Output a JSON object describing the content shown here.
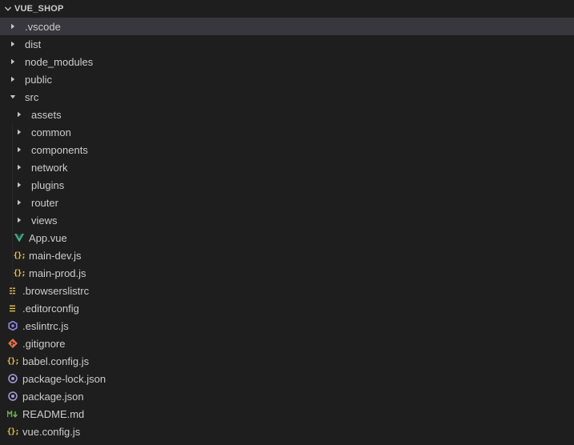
{
  "explorer": {
    "root_label": "VUE_SHOP",
    "colors": {
      "background": "#1e1e1e",
      "selected_row": "#37373d",
      "text": "#cccccc",
      "vue_icon": "#41b883",
      "js_icon": "#e8c04b",
      "config_icon": "#e8c04b",
      "eslint_icon": "#8d87e0",
      "git_icon": "#e5704a",
      "json_icon": "#a49cd8",
      "md_icon": "#6ab04c"
    },
    "items": [
      {
        "label": ".vscode",
        "kind": "folder",
        "state": "collapsed",
        "level": 0,
        "selected": true
      },
      {
        "label": "dist",
        "kind": "folder",
        "state": "collapsed",
        "level": 0
      },
      {
        "label": "node_modules",
        "kind": "folder",
        "state": "collapsed",
        "level": 0
      },
      {
        "label": "public",
        "kind": "folder",
        "state": "collapsed",
        "level": 0
      },
      {
        "label": "src",
        "kind": "folder",
        "state": "expanded",
        "level": 0
      },
      {
        "label": "assets",
        "kind": "folder",
        "state": "collapsed",
        "level": 1
      },
      {
        "label": "common",
        "kind": "folder",
        "state": "collapsed",
        "level": 1
      },
      {
        "label": "components",
        "kind": "folder",
        "state": "collapsed",
        "level": 1
      },
      {
        "label": "network",
        "kind": "folder",
        "state": "collapsed",
        "level": 1
      },
      {
        "label": "plugins",
        "kind": "folder",
        "state": "collapsed",
        "level": 1
      },
      {
        "label": "router",
        "kind": "folder",
        "state": "collapsed",
        "level": 1
      },
      {
        "label": "views",
        "kind": "folder",
        "state": "collapsed",
        "level": 1
      },
      {
        "label": "App.vue",
        "kind": "file",
        "icon": "vue-icon",
        "level": 1
      },
      {
        "label": "main-dev.js",
        "kind": "file",
        "icon": "js-icon",
        "level": 1
      },
      {
        "label": "main-prod.js",
        "kind": "file",
        "icon": "js-icon",
        "level": 1
      },
      {
        "label": ".browserslistrc",
        "kind": "file",
        "icon": "config-lines-icon",
        "level": 0
      },
      {
        "label": ".editorconfig",
        "kind": "file",
        "icon": "config-lines-icon",
        "level": 0
      },
      {
        "label": ".eslintrc.js",
        "kind": "file",
        "icon": "eslint-icon",
        "level": 0
      },
      {
        "label": ".gitignore",
        "kind": "file",
        "icon": "git-icon",
        "level": 0
      },
      {
        "label": "babel.config.js",
        "kind": "file",
        "icon": "js-icon",
        "level": 0
      },
      {
        "label": "package-lock.json",
        "kind": "file",
        "icon": "json-icon",
        "level": 0
      },
      {
        "label": "package.json",
        "kind": "file",
        "icon": "json-icon",
        "level": 0
      },
      {
        "label": "README.md",
        "kind": "file",
        "icon": "markdown-icon",
        "level": 0
      },
      {
        "label": "vue.config.js",
        "kind": "file",
        "icon": "js-icon",
        "level": 0
      }
    ]
  }
}
